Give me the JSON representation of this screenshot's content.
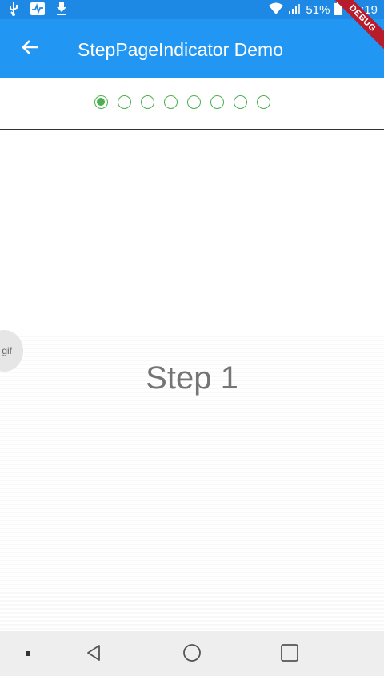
{
  "status_bar": {
    "battery_text": "51%",
    "time": "20:19",
    "icons": [
      "usb-icon",
      "pulse-icon",
      "download-icon",
      "wifi-icon",
      "signal-icon",
      "battery-icon"
    ]
  },
  "app_bar": {
    "title": "StepPageIndicator Demo",
    "back_icon": "arrow-left-icon",
    "color": "#2196f3"
  },
  "debug_banner": {
    "label": "DEBUG"
  },
  "step_indicator": {
    "total": 8,
    "current": 1,
    "color": "#4caf50"
  },
  "page": {
    "label": "Step 1"
  },
  "gif_badge": {
    "label": "gif"
  },
  "nav_bar": {
    "buttons": [
      "back-triangle-icon",
      "home-circle-icon",
      "recents-square-icon"
    ]
  }
}
